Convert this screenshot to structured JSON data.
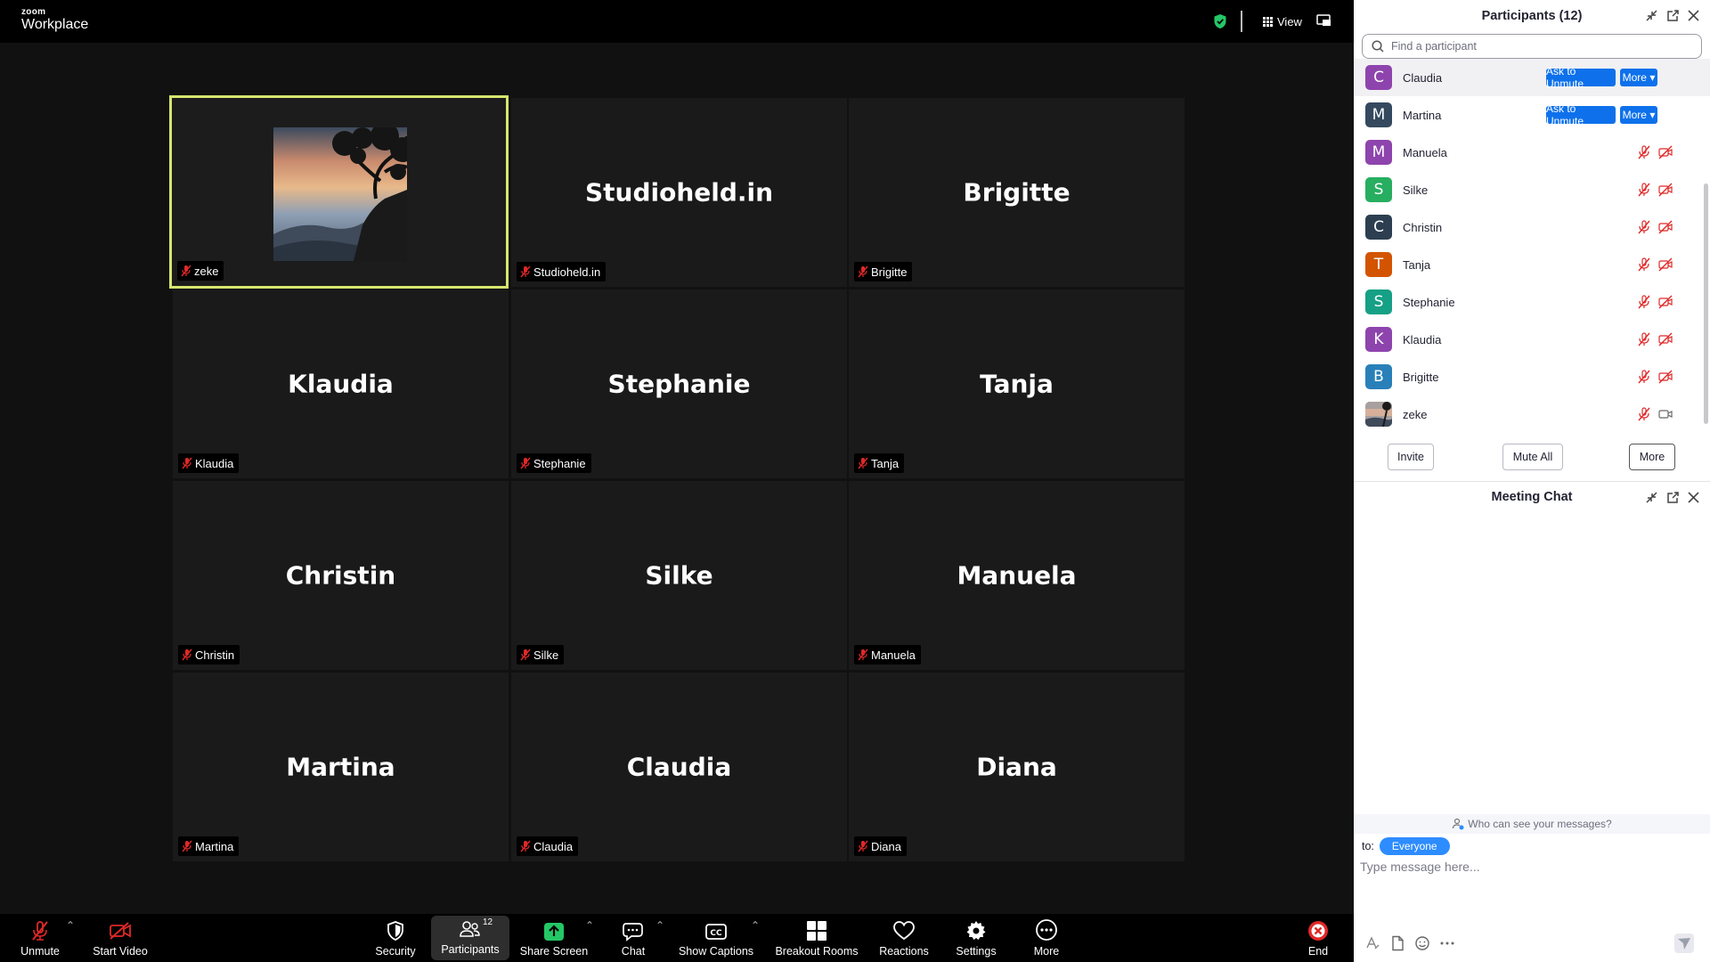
{
  "topbar": {
    "logo_line1": "zoom",
    "logo_line2": "Workplace",
    "view_label": "View"
  },
  "tiles": [
    {
      "name": "zeke",
      "label": "zeke",
      "has_photo": true,
      "active": true
    },
    {
      "name": "Studioheld.in",
      "label": "Studioheld.in"
    },
    {
      "name": "Brigitte",
      "label": "Brigitte"
    },
    {
      "name": "Klaudia",
      "label": "Klaudia"
    },
    {
      "name": "Stephanie",
      "label": "Stephanie"
    },
    {
      "name": "Tanja",
      "label": "Tanja"
    },
    {
      "name": "Christin",
      "label": "Christin"
    },
    {
      "name": "Silke",
      "label": "Silke"
    },
    {
      "name": "Manuela",
      "label": "Manuela"
    },
    {
      "name": "Martina",
      "label": "Martina"
    },
    {
      "name": "Claudia",
      "label": "Claudia"
    },
    {
      "name": "Diana",
      "label": "Diana"
    }
  ],
  "toolbar": {
    "unmute": "Unmute",
    "start_video": "Start Video",
    "security": "Security",
    "participants": "Participants",
    "participants_count": "12",
    "share_screen": "Share Screen",
    "chat": "Chat",
    "show_captions": "Show Captions",
    "breakout_rooms": "Breakout Rooms",
    "reactions": "Reactions",
    "settings": "Settings",
    "more": "More",
    "end": "End"
  },
  "participants_panel": {
    "title": "Participants (12)",
    "search_placeholder": "Find a participant",
    "ask_to_unmute": "Ask to Unmute",
    "more": "More",
    "rows": [
      {
        "initial": "C",
        "name": "Claudia",
        "color": "#8e44ad"
      },
      {
        "initial": "M",
        "name": "Martina",
        "color": "#34495e"
      },
      {
        "initial": "M",
        "name": "Manuela",
        "color": "#8e44ad"
      },
      {
        "initial": "S",
        "name": "Silke",
        "color": "#27ae60"
      },
      {
        "initial": "C",
        "name": "Christin",
        "color": "#2c3e50"
      },
      {
        "initial": "T",
        "name": "Tanja",
        "color": "#d35400"
      },
      {
        "initial": "S",
        "name": "Stephanie",
        "color": "#16a085"
      },
      {
        "initial": "K",
        "name": "Klaudia",
        "color": "#8e44ad"
      },
      {
        "initial": "B",
        "name": "Brigitte",
        "color": "#2980b9"
      },
      {
        "initial": "",
        "name": "zeke",
        "color": "#6a7a8a"
      }
    ],
    "invite": "Invite",
    "mute_all": "Mute All",
    "more_button": "More"
  },
  "chat_panel": {
    "title": "Meeting Chat",
    "who_can_see": "Who can see your messages?",
    "to_label": "to:",
    "recipient": "Everyone",
    "input_placeholder": "Type message here..."
  },
  "colors": {
    "accent_blue": "#0e71eb",
    "active_speaker_border": "#d7e66e",
    "muted_red": "#e02828",
    "share_green": "#24c766",
    "end_red": "#e02828"
  }
}
